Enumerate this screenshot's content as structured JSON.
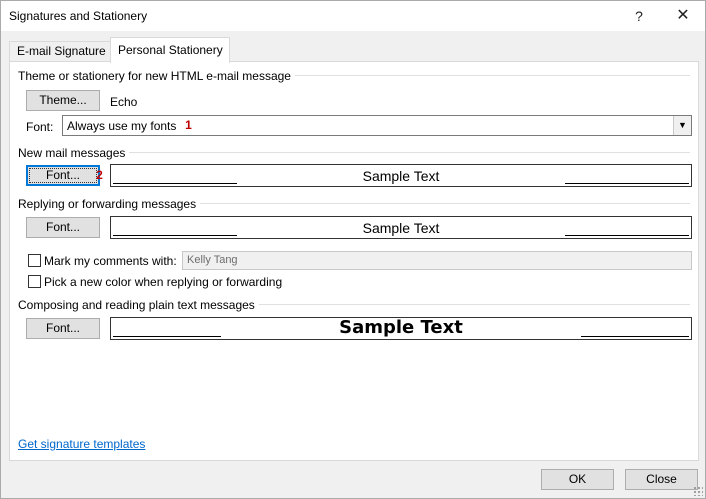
{
  "window": {
    "title": "Signatures and Stationery",
    "help_glyph": "?",
    "close_glyph": "✕"
  },
  "tabs": [
    {
      "label": "E-mail Signature",
      "active": false
    },
    {
      "label": "Personal Stationery",
      "active": true
    }
  ],
  "theme_section": {
    "heading": "Theme or stationery for new HTML e-mail message",
    "theme_button": "Theme...",
    "theme_value": "Echo",
    "font_label": "Font:",
    "font_select_value": "Always use my fonts",
    "font_select_badge": "1"
  },
  "new_mail": {
    "heading": "New mail messages",
    "font_button": "Font...",
    "font_button_badge": "2",
    "sample_text": "Sample Text"
  },
  "reply_forward": {
    "heading": "Replying or forwarding messages",
    "font_button": "Font...",
    "sample_text": "Sample Text",
    "mark_comments_label": "Mark my comments with:",
    "mark_comments_checked": false,
    "mark_comments_value": "Kelly Tang",
    "new_color_label": "Pick a new color when replying or forwarding",
    "new_color_checked": false
  },
  "plain_text": {
    "heading": "Composing and reading plain text messages",
    "font_button": "Font...",
    "sample_text": "Sample Text"
  },
  "footer": {
    "templates_link": "Get signature templates",
    "ok_button": "OK",
    "close_button": "Close"
  },
  "colors": {
    "accent": "#0078d7",
    "badge": "#c00000",
    "link": "#0066cc"
  }
}
